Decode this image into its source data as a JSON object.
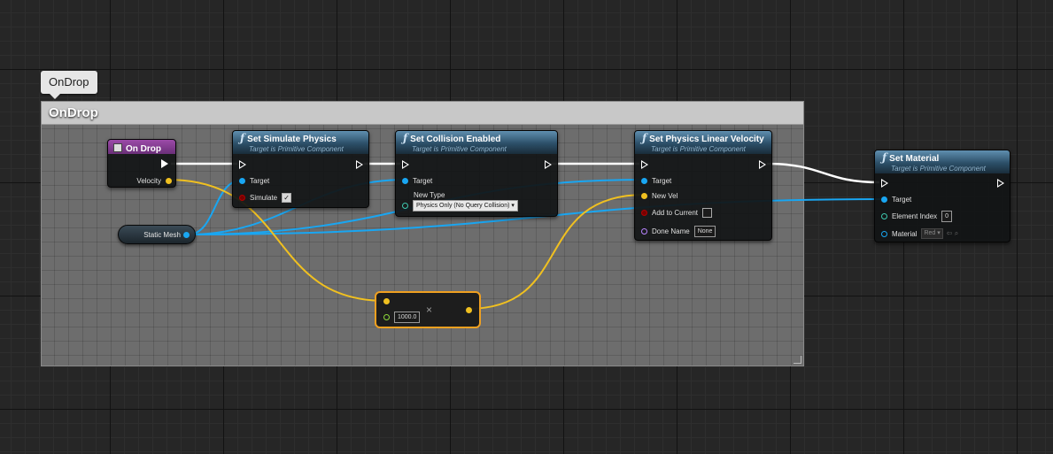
{
  "comment": {
    "bubble_label": "OnDrop",
    "title": "OnDrop"
  },
  "event_node": {
    "title": "On Drop",
    "velocity_label": "Velocity"
  },
  "variable_node": {
    "label": "Static Mesh"
  },
  "set_simulate_physics": {
    "title": "Set Simulate Physics",
    "subtitle": "Target is Primitive Component",
    "target_label": "Target",
    "simulate_label": "Simulate",
    "simulate_checked": true,
    "checkmark": "✓"
  },
  "set_collision_enabled": {
    "title": "Set Collision Enabled",
    "subtitle": "Target is Primitive Component",
    "target_label": "Target",
    "new_type_label": "New Type",
    "new_type_value": "Physics Only (No Query Collision) ▾"
  },
  "set_linear_velocity": {
    "title": "Set Physics Linear Velocity",
    "subtitle": "Target is Primitive Component",
    "target_label": "Target",
    "new_vel_label": "New Vel",
    "add_to_current_label": "Add to Current",
    "done_name_label": "Done Name",
    "done_name_value": "None"
  },
  "set_material": {
    "title": "Set Material",
    "subtitle": "Target is Primitive Component",
    "target_label": "Target",
    "element_index_label": "Element Index",
    "element_index_value": "0",
    "material_label": "Material",
    "material_value": "Red ▾"
  },
  "multiply_node": {
    "value": "1000.0",
    "symbol": "×"
  },
  "icons": {
    "function": "ƒ",
    "browse": "⇦ ⌕"
  },
  "colors": {
    "exec_wire": "#ffffff",
    "object_wire": "#19a6f2",
    "vector_wire": "#f0c020",
    "event_header": "#7a3589",
    "function_header": "#2c4f68",
    "selected_outline": "#f0a020"
  }
}
